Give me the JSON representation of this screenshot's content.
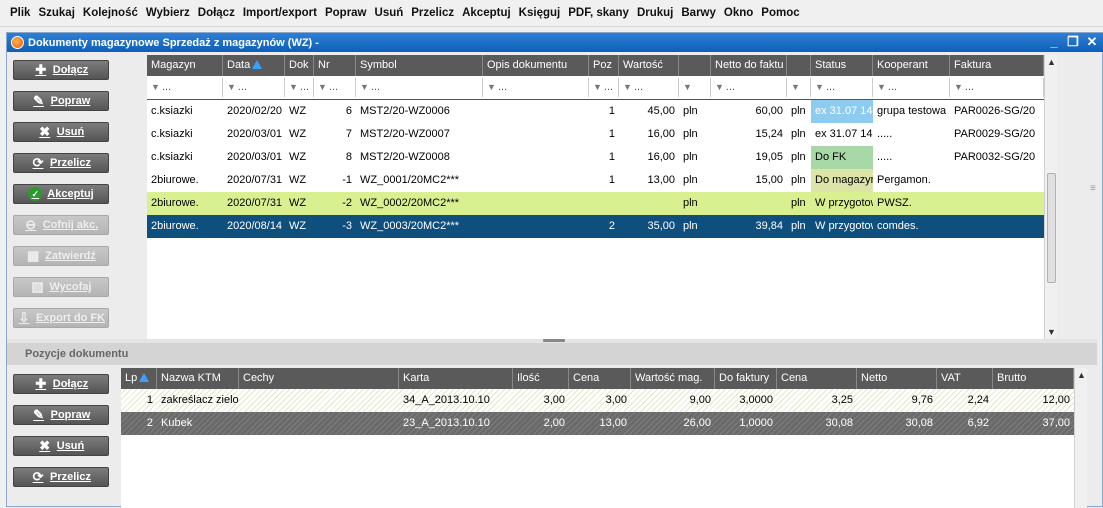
{
  "menu": [
    "Plik",
    "Szukaj",
    "Kolejność",
    "Wybierz",
    "Dołącz",
    "Import/export",
    "Popraw",
    "Usuń",
    "Przelicz",
    "Akceptuj",
    "Księguj",
    "PDF, skany",
    "Drukuj",
    "Barwy",
    "Okno",
    "Pomoc"
  ],
  "window": {
    "title": "Dokumenty magazynowe Sprzedaż z magazynów (WZ)  -"
  },
  "top_buttons": {
    "attach": "Dołącz",
    "edit": "Popraw",
    "delete": "Usuń",
    "recalc": "Przelicz",
    "accept": "Akceptuj",
    "cancel_accept": "Cofnij akc.",
    "approve": "Zatwierdź",
    "withdraw": "Wycofaj",
    "export": "Export do FK"
  },
  "top_grid": {
    "headers": [
      "Magazyn",
      "Data",
      "Dok",
      "Nr",
      "Symbol",
      "Opis dokumentu",
      "Poz",
      "Wartość",
      "",
      "Netto do faktu",
      "",
      "Status",
      "Kooperant",
      "Faktura"
    ],
    "filter_placeholder": "...",
    "rows": [
      [
        "c.ksiazki",
        "2020/02/20",
        "WZ",
        "6",
        "MST2/20-WZ0006",
        "",
        "1",
        "45,00",
        "pln",
        "60,00",
        "pln",
        "ex 31.07 14",
        "grupa testowa",
        "PAR0026-SG/20"
      ],
      [
        "c.ksiazki",
        "2020/03/01",
        "WZ",
        "7",
        "MST2/20-WZ0007",
        "",
        "1",
        "16,00",
        "pln",
        "15,24",
        "pln",
        "ex 31.07 14",
        ".....",
        "PAR0029-SG/20"
      ],
      [
        "c.ksiazki",
        "2020/03/01",
        "WZ",
        "8",
        "MST2/20-WZ0008",
        "",
        "1",
        "16,00",
        "pln",
        "19,05",
        "pln",
        "Do FK",
        ".....",
        "PAR0032-SG/20"
      ],
      [
        "2biurowe.",
        "2020/07/31",
        "WZ",
        "-1",
        "WZ_0001/20MC2***",
        "",
        "1",
        "13,00",
        "pln",
        "15,00",
        "pln",
        "Do magazyn",
        "Pergamon.",
        ""
      ],
      [
        "2biurowe.",
        "2020/07/31",
        "WZ",
        "-2",
        "WZ_0002/20MC2***",
        "",
        "",
        "",
        "pln",
        "",
        "pln",
        "W przygotow",
        "PWSZ.",
        ""
      ],
      [
        "2biurowe.",
        "2020/08/14",
        "WZ",
        "-3",
        "WZ_0003/20MC2***",
        "",
        "2",
        "35,00",
        "pln",
        "39,84",
        "pln",
        "W przygotow",
        "comdes.",
        ""
      ]
    ]
  },
  "section": {
    "title": "Pozycje dokumentu"
  },
  "bottom_buttons": {
    "attach": "Dołącz",
    "edit": "Popraw",
    "delete": "Usuń",
    "recalc": "Przelicz"
  },
  "bottom_grid": {
    "headers": [
      "Lp",
      "Nazwa KTM",
      "Cechy",
      "Karta",
      "Ilość",
      "Cena",
      "Wartość mag.",
      "Do faktury",
      "Cena",
      "Netto",
      "VAT",
      "Brutto"
    ],
    "rows": [
      [
        "1",
        "zakreślacz zielo",
        "",
        "34_A_2013.10.10",
        "3,00",
        "3,00",
        "9,00",
        "3,0000",
        "3,25",
        "9,76",
        "2,24",
        "12,00"
      ],
      [
        "2",
        "Kubek",
        "",
        "23_A_2013.10.10",
        "2,00",
        "13,00",
        "26,00",
        "1,0000",
        "30,08",
        "30,08",
        "6,92",
        "37,00"
      ]
    ]
  },
  "colors": {
    "status_light_blue": "#8ecbf0",
    "status_green": "#a8d8a8",
    "status_yellow": "#dde4a8",
    "row_highlight": "#d8f090",
    "row_selected": "#0e4f7e"
  }
}
